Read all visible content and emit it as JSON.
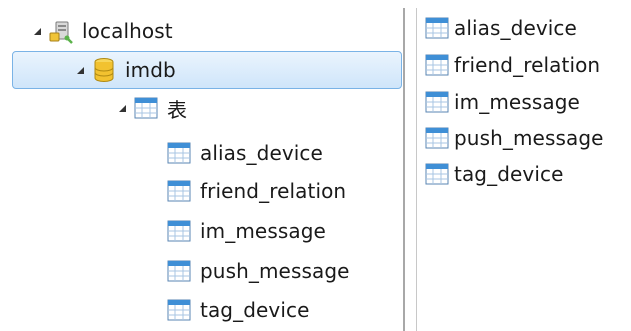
{
  "tree": {
    "server": {
      "label": "localhost",
      "icon": "server-icon"
    },
    "database": {
      "label": "imdb",
      "icon": "database-icon"
    },
    "tables_folder": {
      "label": "表",
      "icon": "tables-folder-icon"
    },
    "tables": [
      {
        "label": "alias_device",
        "icon": "table-icon"
      },
      {
        "label": "friend_relation",
        "icon": "table-icon"
      },
      {
        "label": "im_message",
        "icon": "table-icon"
      },
      {
        "label": "push_message",
        "icon": "table-icon"
      },
      {
        "label": "tag_device",
        "icon": "table-icon"
      }
    ]
  },
  "object_list": {
    "items": [
      {
        "label": "alias_device",
        "icon": "table-icon"
      },
      {
        "label": "friend_relation",
        "icon": "table-icon"
      },
      {
        "label": "im_message",
        "icon": "table-icon"
      },
      {
        "label": "push_message",
        "icon": "table-icon"
      },
      {
        "label": "tag_device",
        "icon": "table-icon"
      }
    ]
  },
  "colors": {
    "selection_border": "#7ab3e6",
    "selection_fill": "#cfe5fa",
    "table_icon_header": "#3f8fd6",
    "database_icon": "#f2c230"
  }
}
